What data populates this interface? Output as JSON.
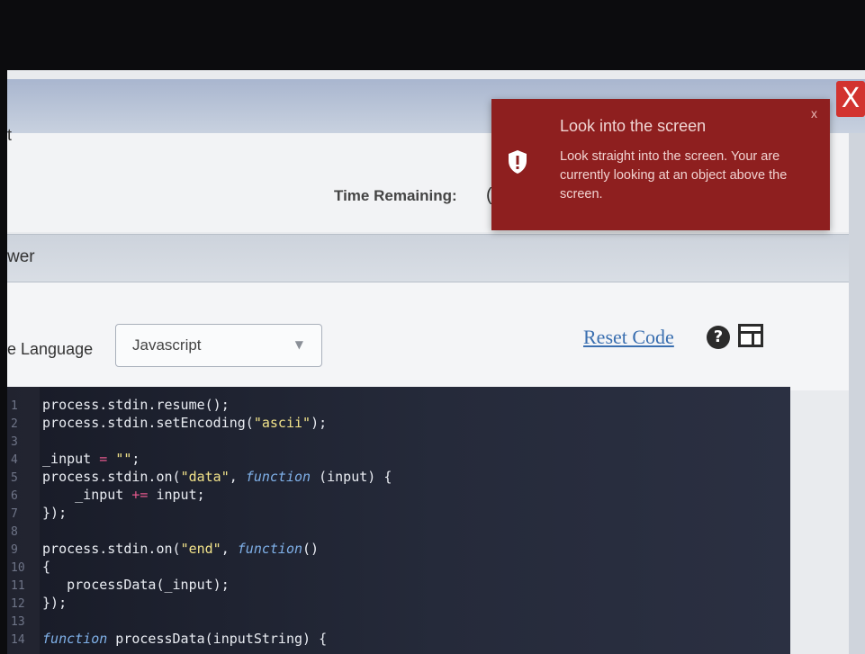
{
  "window": {
    "close_label": "X"
  },
  "header": {
    "left_fragment": "t",
    "time_label": "Time Remaining:",
    "time_value_fragment": "("
  },
  "section": {
    "title_fragment": "wer"
  },
  "controls": {
    "language_label_fragment": "e Language",
    "language_value": "Javascript",
    "reset_code_label": "Reset Code",
    "help_label": "?"
  },
  "toast": {
    "title": "Look into the screen",
    "message": "Look straight into the screen. Your are currently looking at an object above the screen.",
    "close_label": "x",
    "icon": "shield-exclamation-icon"
  },
  "editor": {
    "lines": [
      {
        "n": "1",
        "text": "process.stdin.resume();"
      },
      {
        "n": "2",
        "text": "process.stdin.setEncoding(\"ascii\");"
      },
      {
        "n": "3",
        "text": ""
      },
      {
        "n": "4",
        "text": "_input = \"\";"
      },
      {
        "n": "5",
        "text": "process.stdin.on(\"data\", function (input) {"
      },
      {
        "n": "6",
        "text": "    _input += input;"
      },
      {
        "n": "7",
        "text": "});"
      },
      {
        "n": "8",
        "text": ""
      },
      {
        "n": "9",
        "text": "process.stdin.on(\"end\", function()"
      },
      {
        "n": "10",
        "text": "{"
      },
      {
        "n": "11",
        "text": "   processData(_input);"
      },
      {
        "n": "12",
        "text": "});"
      },
      {
        "n": "13",
        "text": ""
      },
      {
        "n": "14",
        "text": "function processData(inputString) {"
      }
    ]
  },
  "colors": {
    "toast_bg": "#8e1f1f",
    "editor_bg": "#1f2331",
    "link": "#3a6fb0",
    "close_btn": "#d2332f"
  }
}
